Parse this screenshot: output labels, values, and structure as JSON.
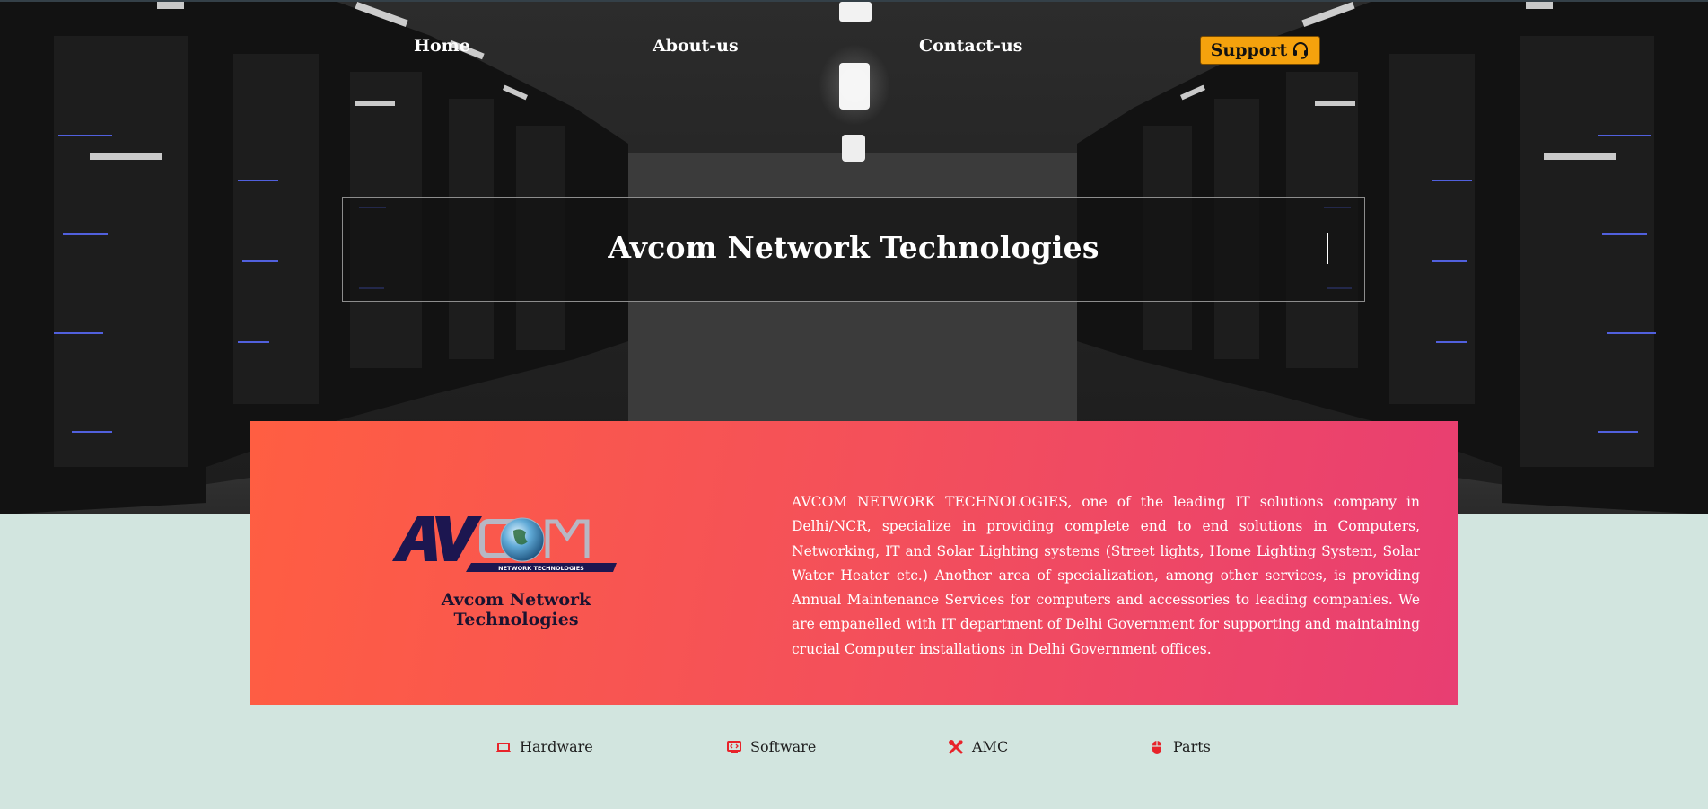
{
  "nav": {
    "home": "Home",
    "about": "About-us",
    "contact": "Contact-us",
    "support": "Support",
    "support_icon": "headset-icon"
  },
  "hero": {
    "title": "Avcom Network Technologies",
    "background": "server-room-corridor"
  },
  "about": {
    "logo_text": "AVCOM",
    "logo_subtext": "NETWORK TECHNOLOGIES",
    "logo_caption": "Avcom Network Technologies",
    "description": "AVCOM NETWORK TECHNOLOGIES, one of the leading IT solutions company in Delhi/NCR, specialize in providing complete end to end solutions in Computers, Networking, IT and Solar Lighting systems (Street lights, Home Lighting System, Solar Water Heater etc.) Another area of specialization, among other services, is providing Annual Maintenance Services for computers and accessories to leading companies. We are empanelled with IT department of Delhi Government for supporting and maintaining crucial Computer installations in Delhi Government offices."
  },
  "services": [
    {
      "label": "Hardware",
      "icon": "laptop-icon"
    },
    {
      "label": "Software",
      "icon": "monitor-code-icon"
    },
    {
      "label": "AMC",
      "icon": "tools-icon"
    },
    {
      "label": "Parts",
      "icon": "mouse-icon"
    }
  ],
  "colors": {
    "support_button": "#f5a20d",
    "card_gradient_start": "#ff5e42",
    "card_gradient_end": "#e83e72",
    "page_background": "#d2e5df",
    "icon_accent": "#e8232a",
    "logo_navy": "#1c1650"
  }
}
